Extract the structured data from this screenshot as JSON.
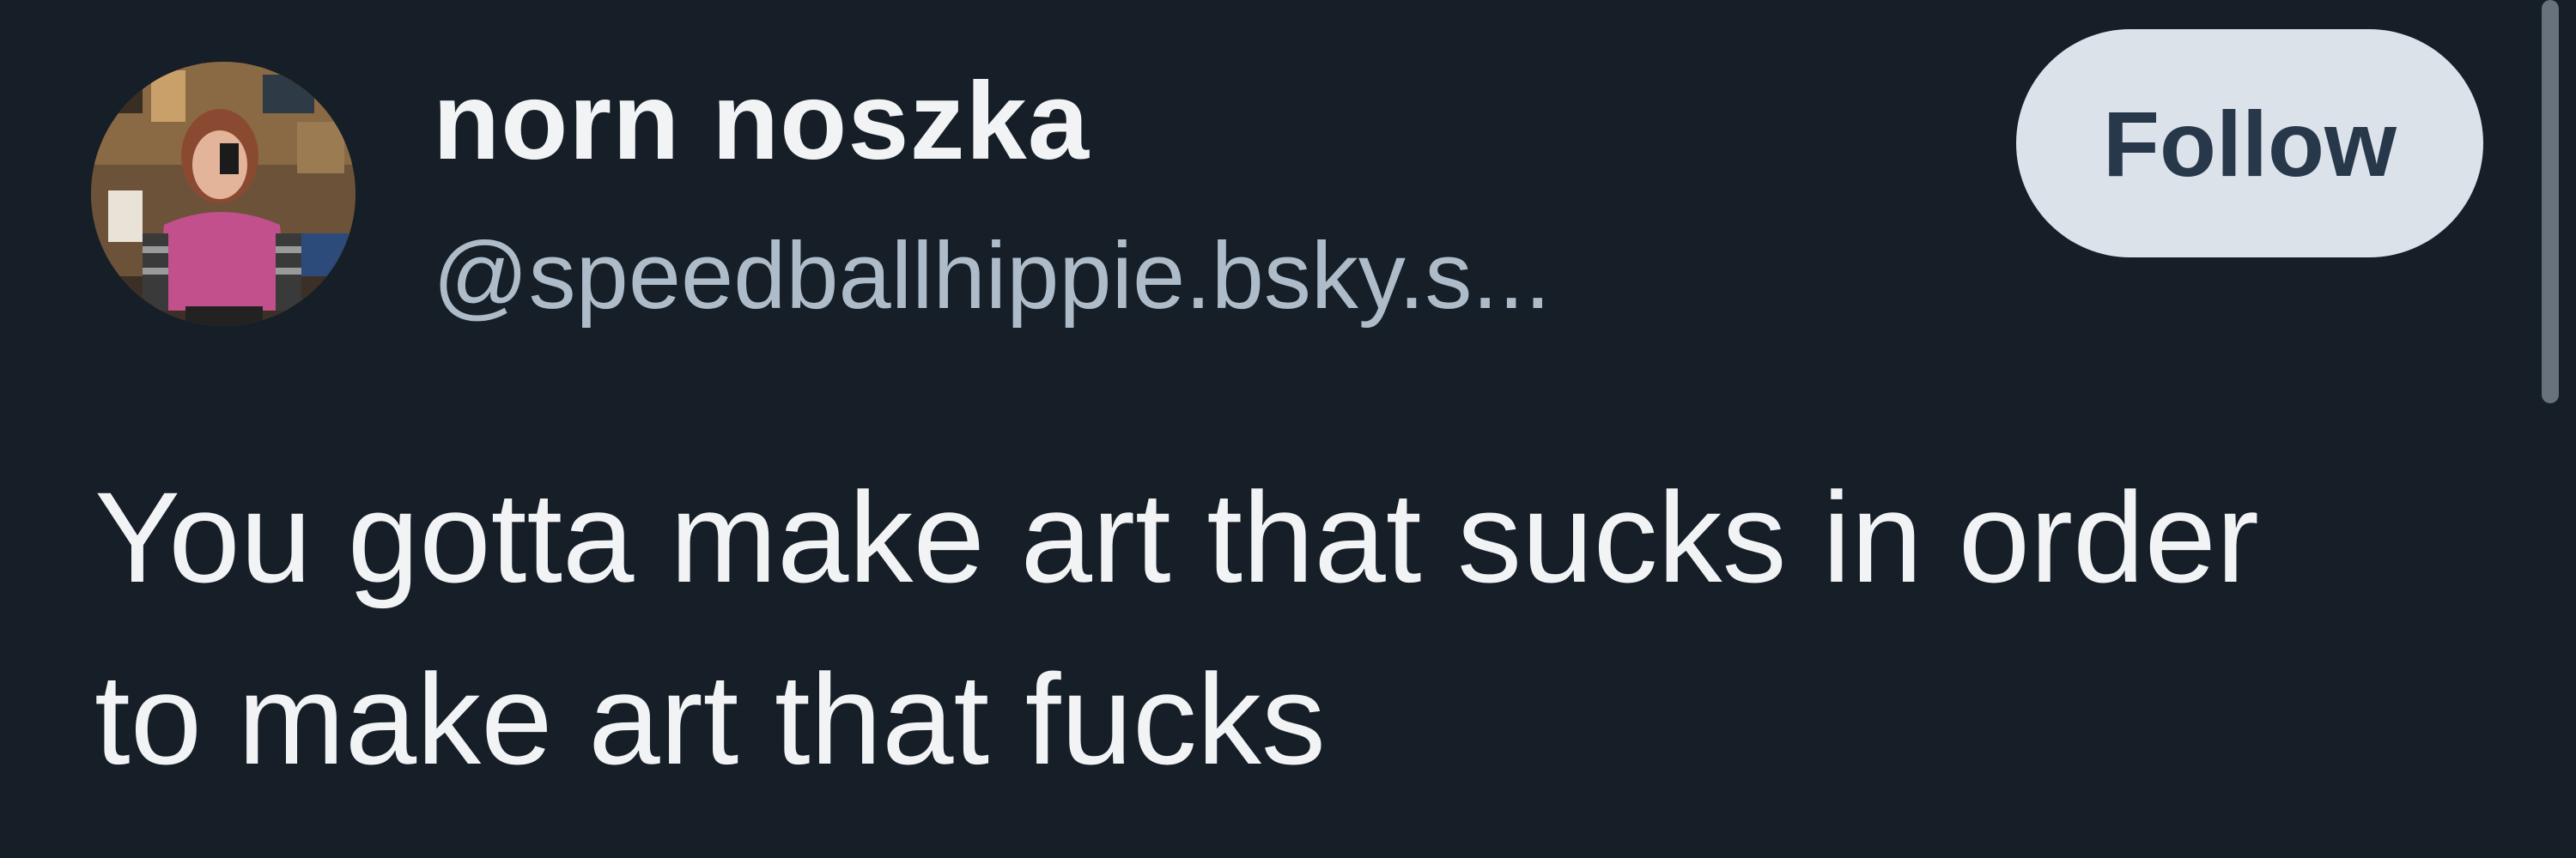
{
  "post": {
    "author": {
      "display_name": "norn noszka",
      "handle": "@speedballhippie.bsky.s..."
    },
    "follow_label": "Follow",
    "text": "You gotta make art that sucks in order\nto make art that fucks"
  },
  "colors": {
    "background": "#161e27",
    "name": "#f1f3f5",
    "handle": "#aebbc9",
    "follow_bg": "#dce2ea",
    "follow_text": "#28384b"
  }
}
